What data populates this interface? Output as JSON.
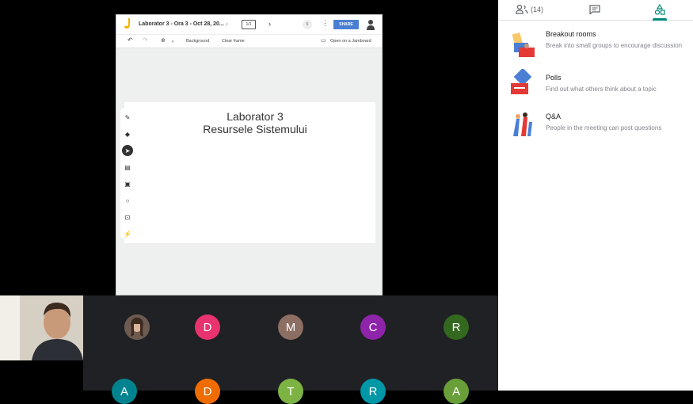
{
  "jamboard": {
    "title": "Laborator 3 - Ora 3 - Oct 28, 20...",
    "frame_counter": "1/1",
    "viewer_count": "6",
    "share_label": "SHARE",
    "toolbar": {
      "background_label": "Background",
      "clear_frame_label": "Clear frame",
      "open_jamboard_label": "Open on a Jamboard"
    },
    "board_line1": "Laborator 3",
    "board_line2": "Resursele Sistemului"
  },
  "participants_row1": [
    {
      "initial": "",
      "color": "#5f6368"
    },
    {
      "initial": "D",
      "color": "#e8336f"
    },
    {
      "initial": "M",
      "color": "#8d6e63"
    },
    {
      "initial": "C",
      "color": "#8e24aa"
    },
    {
      "initial": "R",
      "color": "#33691e"
    }
  ],
  "participants_row2": [
    {
      "initial": "",
      "color": "#c2185b"
    },
    {
      "initial": "A",
      "color": "#00838f"
    },
    {
      "initial": "D",
      "color": "#ef6c00"
    },
    {
      "initial": "T",
      "color": "#7cb342"
    },
    {
      "initial": "R",
      "color": "#0097a7"
    },
    {
      "initial": "A",
      "color": "#689f38"
    }
  ],
  "panel": {
    "people_count": "(14)",
    "activities": [
      {
        "title": "Breakout rooms",
        "desc": "Break into small groups to encourage discussion"
      },
      {
        "title": "Polls",
        "desc": "Find out what others think about a topic"
      },
      {
        "title": "Q&A",
        "desc": "People in the meeting can post questions"
      }
    ]
  },
  "colors": {
    "accent": "#00897b",
    "share": "#4a7fd4"
  }
}
